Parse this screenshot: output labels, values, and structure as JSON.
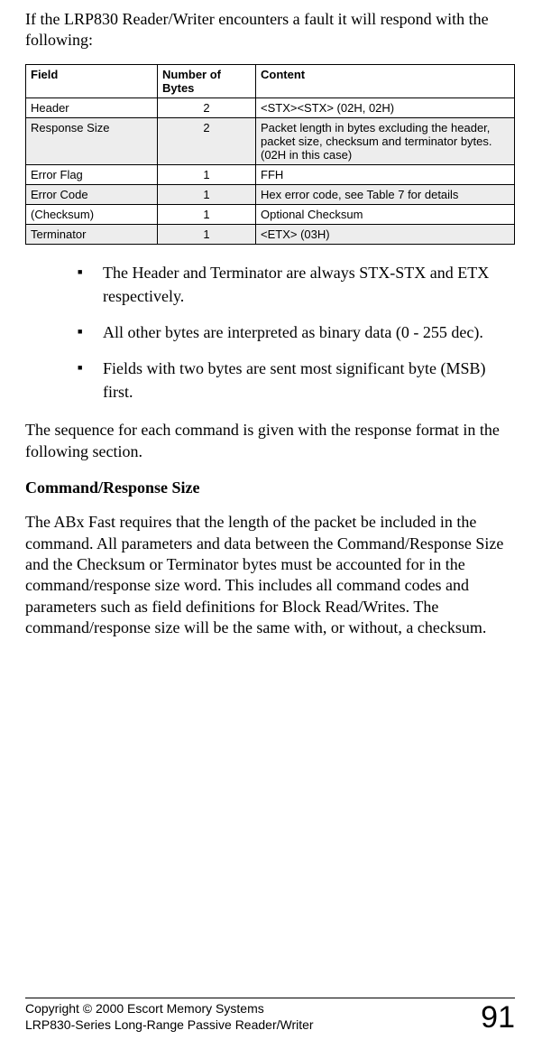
{
  "intro": "If the LRP830 Reader/Writer encounters a fault it will respond with the following:",
  "table": {
    "headers": [
      "Field",
      "Number of Bytes",
      "Content"
    ],
    "rows": [
      {
        "field": "Header",
        "bytes": "2",
        "content": "<STX><STX> (02H, 02H)",
        "shaded": false
      },
      {
        "field": "Response Size",
        "bytes": "2",
        "content": "Packet length in bytes excluding the header, packet size, checksum and terminator bytes. (02H in this case)",
        "shaded": true
      },
      {
        "field": "Error Flag",
        "bytes": "1",
        "content": "FFH",
        "shaded": false
      },
      {
        "field": "Error Code",
        "bytes": "1",
        "content": "Hex error code, see Table 7 for details",
        "shaded": true
      },
      {
        "field": "(Checksum)",
        "bytes": "1",
        "content": "Optional Checksum",
        "shaded": false
      },
      {
        "field": "Terminator",
        "bytes": "1",
        "content": "<ETX> (03H)",
        "shaded": true
      }
    ]
  },
  "bullets": [
    "The Header and Terminator are always STX-STX and ETX respectively.",
    "All other bytes are interpreted as binary data (0 - 255 dec).",
    "Fields with two bytes are sent most significant byte (MSB) first."
  ],
  "sequence_para": "The sequence for each command is given with the response format in the following section.",
  "subheading": "Command/Response Size",
  "body_para": "The ABx Fast requires that the length of the packet be included in the command. All parameters and data between the Command/Response Size and the Checksum or Terminator bytes must be accounted for in the command/response size word. This includes all command codes and parameters such as field definitions for Block Read/Writes. The command/response size will be the same with, or without, a checksum.",
  "footer": {
    "line1": "Copyright © 2000 Escort Memory Systems",
    "line2": "LRP830-Series Long-Range Passive Reader/Writer",
    "page": "91"
  }
}
